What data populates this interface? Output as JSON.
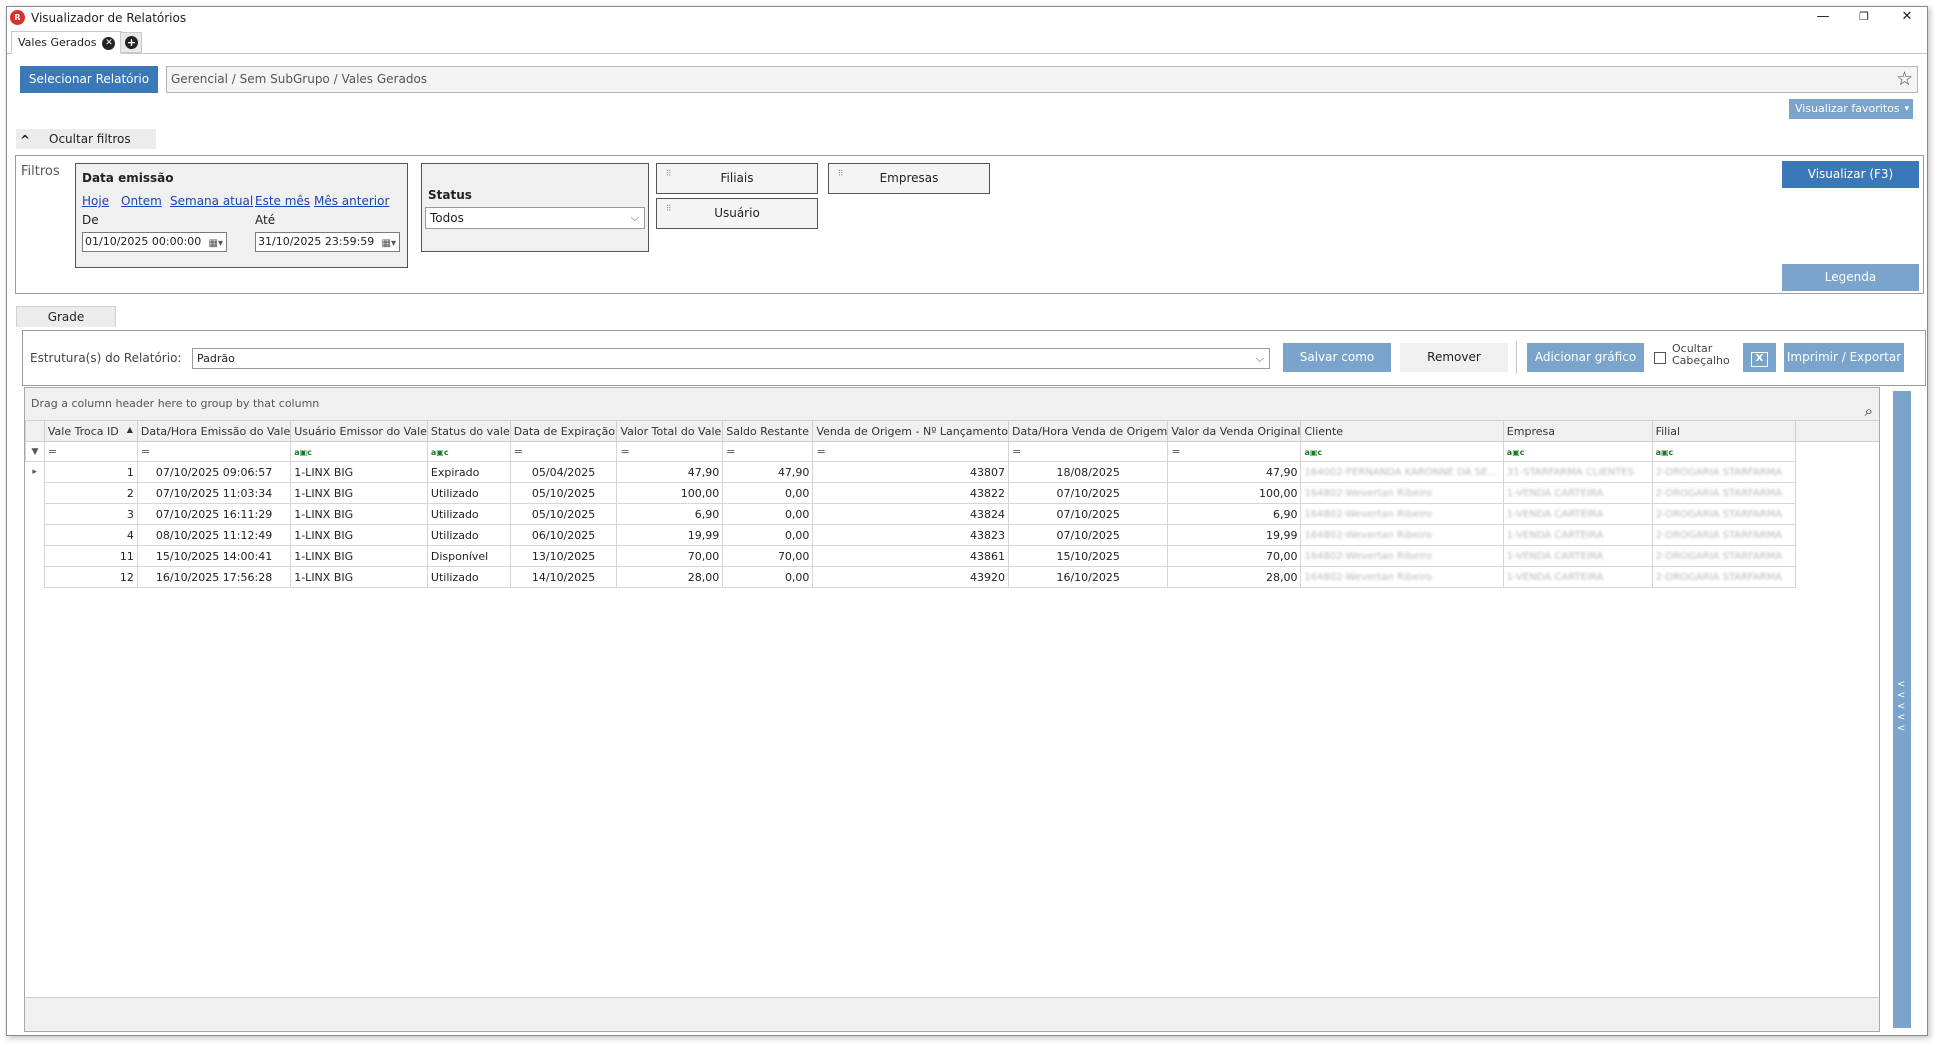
{
  "window": {
    "title": "Visualizador de Relatórios",
    "app_icon": "report-app-icon",
    "min_glyph": "—",
    "max_glyph": "❐",
    "close_glyph": "✕"
  },
  "tabs": [
    {
      "label": "Vales Gerados",
      "close_glyph": "✕"
    }
  ],
  "add_tab_glyph": "+",
  "select_report_label": "Selecionar Relatório",
  "breadcrumb": "Gerencial / Sem SubGrupo / Vales Gerados",
  "favorite_glyph": "☆",
  "view_favorites_label": "Visualizar favoritos",
  "view_favorites_arrow": "▾",
  "hide_filters_label": "Ocultar filtros",
  "hide_filters_chevron": "^",
  "filters": {
    "title": "Filtros",
    "date_group": {
      "title": "Data emissão",
      "quick_links": [
        "Hoje",
        "Ontem",
        "Semana atual",
        "Este mês",
        "Mês anterior"
      ],
      "from_label": "De",
      "from_value": "01/10/2025 00:00:00",
      "to_label": "Até",
      "to_value": "31/10/2025 23:59:59"
    },
    "status_group": {
      "title": "Status",
      "selected": "Todos"
    },
    "group_buttons": [
      "Filiais",
      "Empresas",
      "Usuário"
    ],
    "grip_glyph": "⠿",
    "view_button": "Visualizar (F3)",
    "legend_button": "Legenda"
  },
  "grade_tab": "Grade",
  "structure": {
    "label": "Estrutura(s) do Relatório:",
    "selected": "Padrão",
    "save_as": "Salvar como",
    "remove": "Remover",
    "add_chart": "Adicionar gráfico",
    "hide_header_line1": "Ocultar",
    "hide_header_line2": "Cabeçalho",
    "excel_glyph": "X",
    "print_export": "Imprimir / Exportar"
  },
  "grid": {
    "group_hint": "Drag a column header here to group by that column",
    "search_glyph": "⌕",
    "filter_glyph": "▼",
    "row_indicator": "▸",
    "sort_glyph": "▲",
    "eq_glyph": "=",
    "abc_glyph": "a▣c",
    "columns": [
      "Vale Troca ID",
      "Data/Hora Emissão do Vale",
      "Usuário Emissor do Vale",
      "Status do vale",
      "Data de Expiração",
      "Valor Total do Vale",
      "Saldo Restante",
      "Venda de Origem - Nº Lançamento",
      "Data/Hora Venda de Origem",
      "Valor da Venda Original",
      "Cliente",
      "Empresa",
      "Filial"
    ],
    "filter_types": [
      "eq",
      "eq",
      "abc",
      "abc",
      "eq",
      "eq",
      "eq",
      "eq",
      "eq",
      "eq",
      "abc",
      "abc",
      "abc"
    ],
    "rows": [
      [
        "1",
        "07/10/2025 09:06:57",
        "1-LINX BIG",
        "Expirado",
        "05/04/2025",
        "47,90",
        "47,90",
        "43807",
        "18/08/2025",
        "47,90",
        "164002-FERNANDA KARONNE DA SE...",
        "31-STARFARMA CLIENTES",
        "2-DROGARIA STARFARMA"
      ],
      [
        "2",
        "07/10/2025 11:03:34",
        "1-LINX BIG",
        "Utilizado",
        "05/10/2025",
        "100,00",
        "0,00",
        "43822",
        "07/10/2025",
        "100,00",
        "164802-Wevertan Ribeiro",
        "1-VENDA CARTEIRA",
        "2-DROGARIA STARFARMA"
      ],
      [
        "3",
        "07/10/2025 16:11:29",
        "1-LINX BIG",
        "Utilizado",
        "05/10/2025",
        "6,90",
        "0,00",
        "43824",
        "07/10/2025",
        "6,90",
        "164802-Wevertan Ribeiro",
        "1-VENDA CARTEIRA",
        "2-DROGARIA STARFARMA"
      ],
      [
        "4",
        "08/10/2025 11:12:49",
        "1-LINX BIG",
        "Utilizado",
        "06/10/2025",
        "19,99",
        "0,00",
        "43823",
        "07/10/2025",
        "19,99",
        "164802-Wevertan Ribeiro",
        "1-VENDA CARTEIRA",
        "2-DROGARIA STARFARMA"
      ],
      [
        "11",
        "15/10/2025 14:00:41",
        "1-LINX BIG",
        "Disponível",
        "13/10/2025",
        "70,00",
        "70,00",
        "43861",
        "15/10/2025",
        "70,00",
        "164802-Wevertan Ribeiro",
        "1-VENDA CARTEIRA",
        "2-DROGARIA STARFARMA"
      ],
      [
        "12",
        "16/10/2025 17:56:28",
        "1-LINX BIG",
        "Utilizado",
        "14/10/2025",
        "28,00",
        "0,00",
        "43920",
        "16/10/2025",
        "28,00",
        "164802-Wevertan Ribeiro",
        "1-VENDA CARTEIRA",
        "2-DROGARIA STARFARMA"
      ]
    ]
  },
  "side_panel_glyph": "<",
  "colors": {
    "primary": "#3b78b8",
    "light_primary": "#7aa4cc"
  }
}
